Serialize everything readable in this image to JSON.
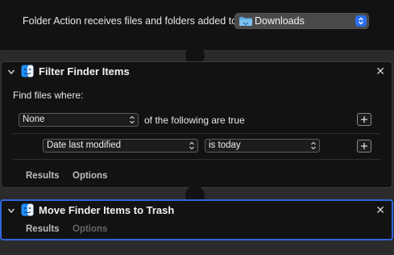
{
  "header": {
    "label": "Folder Action receives files and folders added to",
    "folder": "Downloads"
  },
  "filter_action": {
    "title": "Filter Finder Items",
    "find_label": "Find files where:",
    "match_select": "None",
    "match_suffix": "of the following are true",
    "criterion": {
      "attribute": "Date last modified",
      "operator": "is today"
    },
    "tabs": [
      "Results",
      "Options"
    ]
  },
  "trash_action": {
    "title": "Move Finder Items to Trash",
    "tabs": [
      "Results",
      "Options"
    ]
  },
  "colors": {
    "background": "#121212",
    "canvas": "#2b2b2b",
    "accent": "#2f66d9",
    "folder_blue": "#5aa9e6"
  },
  "icons": [
    "folder-icon",
    "finder-icon",
    "chevron-down-icon",
    "close-icon",
    "plus-icon",
    "updown-arrows-icon"
  ]
}
